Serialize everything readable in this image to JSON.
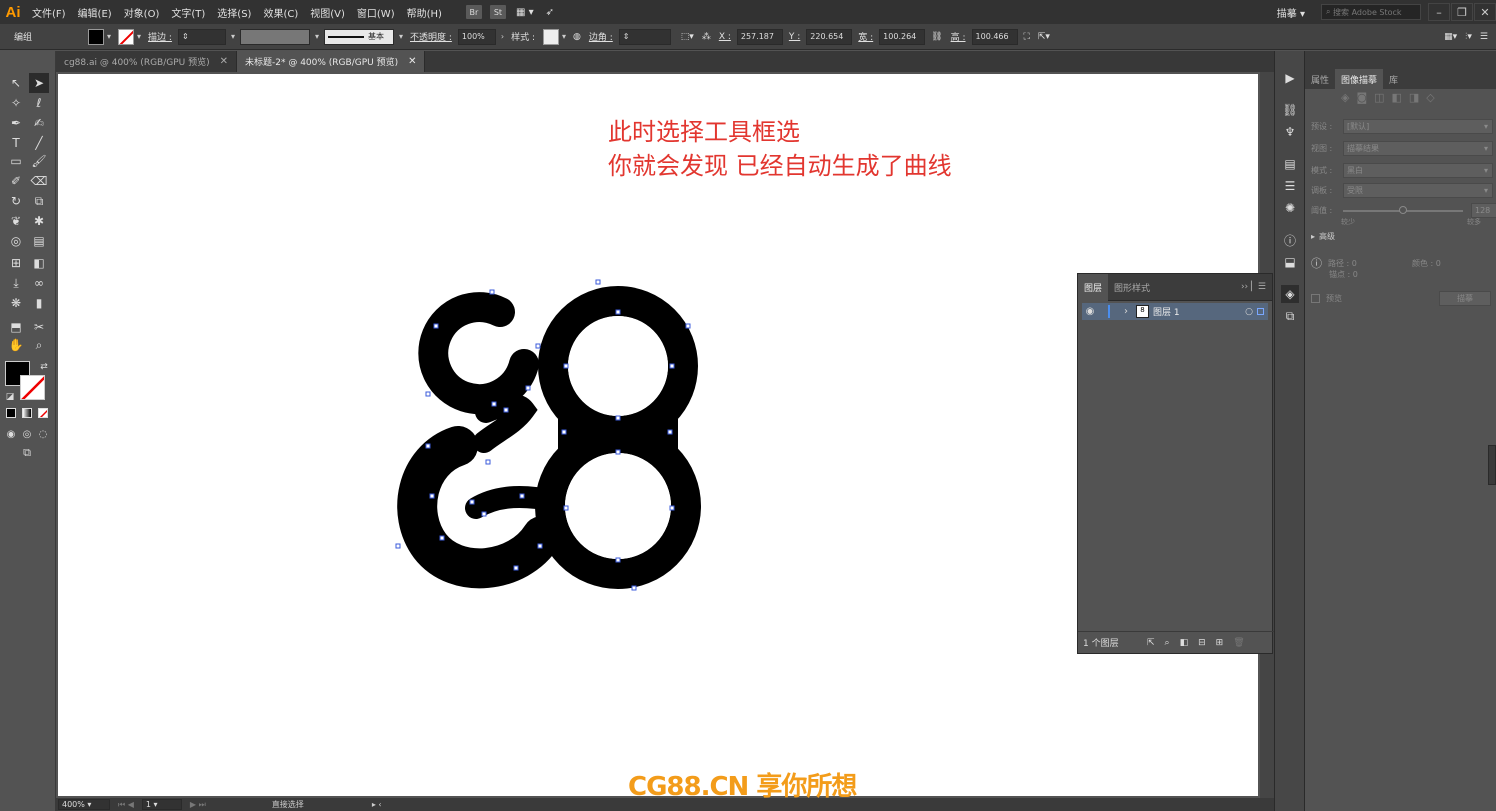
{
  "app": {
    "logo": "Ai",
    "workspace": "描摹",
    "stock_search_placeholder": "搜索 Adobe Stock"
  },
  "menu": [
    "文件(F)",
    "编辑(E)",
    "对象(O)",
    "文字(T)",
    "选择(S)",
    "效果(C)",
    "视图(V)",
    "窗口(W)",
    "帮助(H)"
  ],
  "menu_boxes": [
    "Br",
    "St"
  ],
  "control": {
    "selection": "编组",
    "stroke_label": "描边 :",
    "stroke_style": "基本",
    "opacity_label": "不透明度 :",
    "opacity_value": "100%",
    "style_label": "样式 :",
    "corner_label": "边角 :",
    "x_label": "X :",
    "x_value": "257.187",
    "y_label": "Y :",
    "y_value": "220.654",
    "w_label": "宽 :",
    "w_value": "100.264",
    "h_label": "高 :",
    "h_value": "100.466"
  },
  "tabs": [
    {
      "label": "cg88.ai @ 400% (RGB/GPU 预览)"
    },
    {
      "label": "未标题-2* @ 400% (RGB/GPU 预览)"
    }
  ],
  "canvas": {
    "note_line1": "此时选择工具框选",
    "note_line2": "你就会发现  已经自动生成了曲线"
  },
  "status": {
    "zoom": "400%",
    "page": "1",
    "tool": "直接选择"
  },
  "watermark": "CG88.CN 享你所想",
  "layers_panel": {
    "tab_layers": "图层",
    "tab_graphic_styles": "图形样式",
    "layer_name": "图层 1",
    "footer": "1 个图层"
  },
  "image_trace": {
    "tab_properties": "属性",
    "tab_image_trace": "图像描摹",
    "tab_library": "库",
    "preset_label": "预设 :",
    "preset_value": "[默认]",
    "view_label": "视图 :",
    "view_value": "描摹结果",
    "mode_label": "模式 :",
    "mode_value": "黑白",
    "palette_label": "调板 :",
    "palette_value": "受限",
    "threshold_label": "阈值 :",
    "threshold_value": "128",
    "threshold_min": "较少",
    "threshold_max": "较多",
    "threshold_fraction": 0.5,
    "advanced": "高级",
    "paths_label": "路径 : 0",
    "colors_label": "颜色 : 0",
    "anchors_label": "锚点 : 0",
    "preview_label": "预览",
    "trace_button": "描摹"
  },
  "colors": {
    "note_red": "#e2362f",
    "watermark_orange": "#f39c1a",
    "anchor_blue": "#3b5bdb",
    "layer_row": "#56677d"
  }
}
